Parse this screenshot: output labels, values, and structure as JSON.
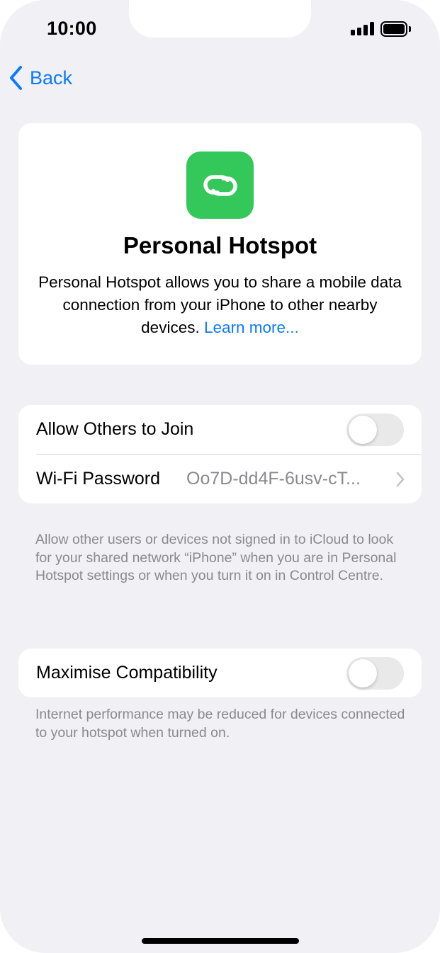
{
  "status_bar": {
    "time": "10:00",
    "signal_icon": "cellular-signal-icon",
    "battery_icon": "battery-icon"
  },
  "nav": {
    "back_label": "Back",
    "back_icon": "chevron-left-icon"
  },
  "hero": {
    "icon": "personal-hotspot-link-icon",
    "icon_color": "#34c759",
    "title": "Personal Hotspot",
    "description": "Personal Hotspot allows you to share a mobile data connection from your iPhone to other nearby devices.",
    "learn_more": "Learn more..."
  },
  "settings": {
    "allow_others": {
      "label": "Allow Others to Join",
      "enabled": false
    },
    "wifi_password": {
      "label": "Wi-Fi Password",
      "value": "Oo7D-dd4F-6usv-cT..."
    },
    "allow_others_footnote": "Allow other users or devices not signed in to iCloud to look for your shared network “iPhone” when you are in Personal Hotspot settings or when you turn it on in Control Centre.",
    "maximise_compatibility": {
      "label": "Maximise Compatibility",
      "enabled": false
    },
    "maximise_footnote": "Internet performance may be reduced for devices connected to your hotspot when turned on."
  },
  "colors": {
    "accent": "#0a7aff",
    "background": "#f0f0f5",
    "secondary_text": "#8a8a8e"
  }
}
